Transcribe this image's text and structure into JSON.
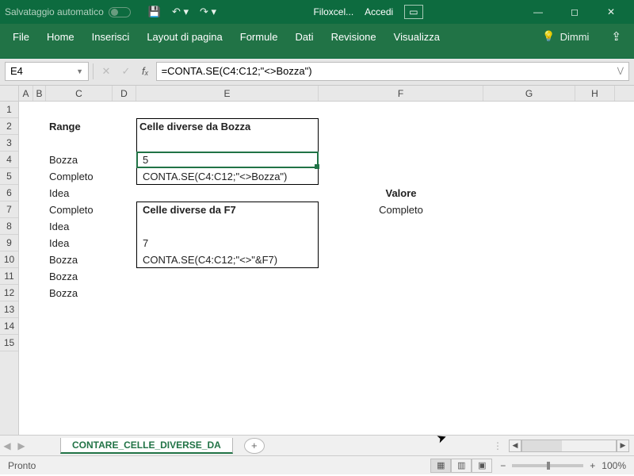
{
  "titlebar": {
    "autosave": "Salvataggio automatico",
    "filename": "Filoxcel...",
    "signin": "Accedi"
  },
  "ribbon": {
    "file": "File",
    "home": "Home",
    "insert": "Inserisci",
    "layout": "Layout di pagina",
    "formulas": "Formule",
    "data": "Dati",
    "review": "Revisione",
    "view": "Visualizza",
    "tellme": "Dimmi"
  },
  "namebox": "E4",
  "formula": "=CONTA.SE(C4:C12;\"<>Bozza\")",
  "cols": {
    "A": "A",
    "B": "B",
    "C": "C",
    "D": "D",
    "E": "E",
    "F": "F",
    "G": "G",
    "H": "H"
  },
  "cells": {
    "C2": "Range",
    "E2": "Celle diverse da Bozza",
    "C4": "Bozza",
    "C5": "Completo",
    "C6": "Idea",
    "C7": "Completo",
    "C8": "Idea",
    "C9": "Idea",
    "C10": "Bozza",
    "C11": "Bozza",
    "C12": "Bozza",
    "E4": "5",
    "E5": "CONTA.SE(C4:C12;\"<>Bozza\")",
    "E7": "Celle diverse da F7",
    "E9": "7",
    "E10": "CONTA.SE(C4:C12;\"<>\"&F7)",
    "F6": "Valore",
    "F7": "Completo"
  },
  "sheet": "CONTARE_CELLE_DIVERSE_DA",
  "status": {
    "ready": "Pronto",
    "zoom": "100%"
  }
}
